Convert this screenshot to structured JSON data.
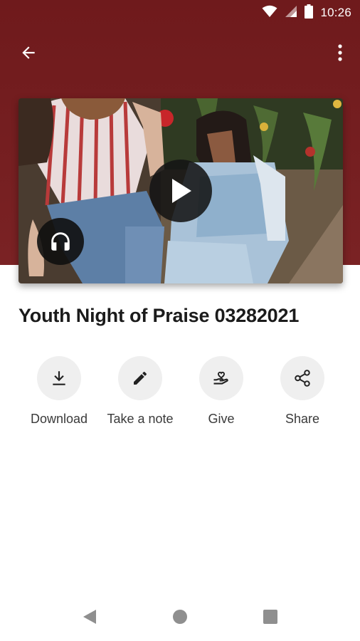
{
  "status_bar": {
    "time": "10:26"
  },
  "app_bar": {
    "back_icon": "arrow-back-icon",
    "menu_icon": "more-vert-icon"
  },
  "media": {
    "play_icon": "play-icon",
    "audio_icon": "headphones-icon"
  },
  "sermon": {
    "title": "Youth Night of Praise 03282021"
  },
  "actions": [
    {
      "label": "Download",
      "icon": "download-icon"
    },
    {
      "label": "Take a note",
      "icon": "pencil-icon"
    },
    {
      "label": "Give",
      "icon": "heart-hand-icon"
    },
    {
      "label": "Share",
      "icon": "share-icon"
    }
  ],
  "colors": {
    "header": "#7a2224",
    "action_bg": "#efefef",
    "title": "#1b1b1b"
  }
}
